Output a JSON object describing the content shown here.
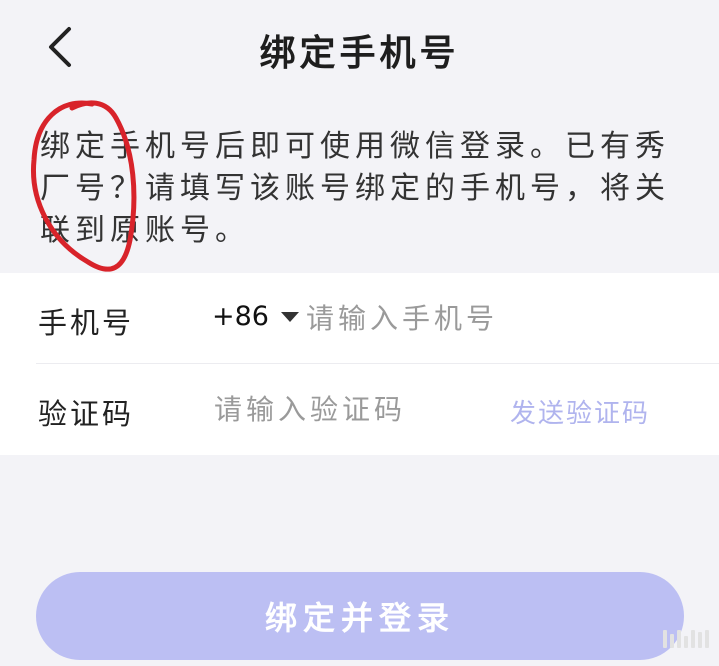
{
  "header": {
    "title": "绑定手机号",
    "back_icon": "chevron-left-icon"
  },
  "description": "绑定手机号后即可使用微信登录。已有秀厂号？请填写该账号绑定的手机号，将关联到原账号。",
  "form": {
    "phone_row": {
      "label": "手机号",
      "country_code": "+86",
      "placeholder": "请输入手机号"
    },
    "code_row": {
      "label": "验证码",
      "placeholder": "请输入验证码",
      "send_label": "发送验证码"
    }
  },
  "submit_label": "绑定并登录",
  "colors": {
    "background": "#f3f3f7",
    "accent": "#bcbff3",
    "send_code_text": "#b0b4ee",
    "annotation_red": "#d8232a"
  }
}
